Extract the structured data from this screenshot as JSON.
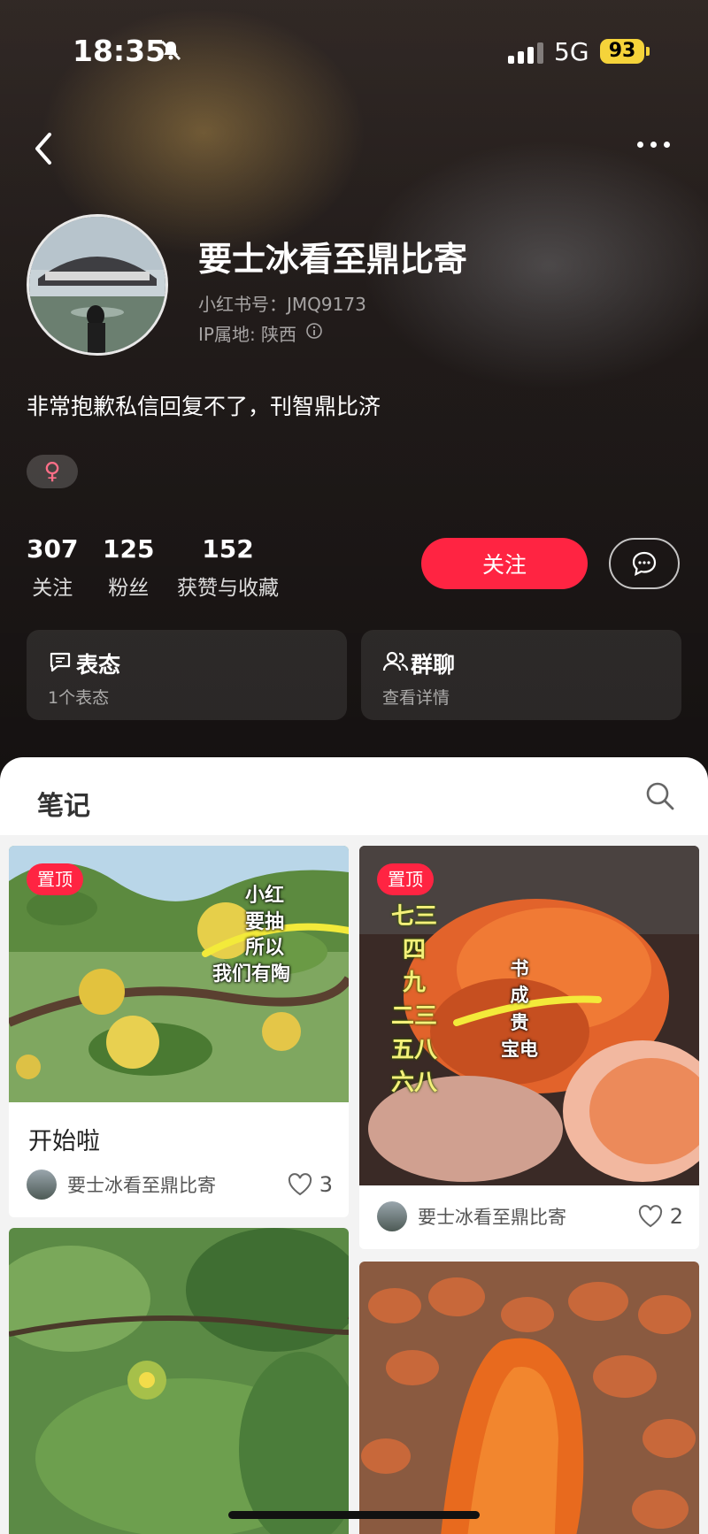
{
  "status": {
    "time": "18:35",
    "network": "5G",
    "battery": "93"
  },
  "profile": {
    "name": "要士冰看至鼎比寄",
    "id_line": "小红书号：JMQ9173",
    "ip_line": "IP属地: 陕西",
    "bio": "非常抱歉私信回复不了，刊智鼎比济",
    "gender_symbol": "♀"
  },
  "stats": [
    {
      "num": "307",
      "label": "关注"
    },
    {
      "num": "125",
      "label": "粉丝"
    },
    {
      "num": "152",
      "label": "获赞与收藏"
    }
  ],
  "actions": {
    "follow": "关注"
  },
  "cards": [
    {
      "title": "表态",
      "sub": "1个表态"
    },
    {
      "title": "群聊",
      "sub": "查看详情"
    }
  ],
  "sheet": {
    "tab": "笔记"
  },
  "notes": [
    {
      "pin": "置顶",
      "title": "开始啦",
      "author": "要士冰看至鼎比寄",
      "likes": "3",
      "overlay": [
        "小红",
        "要抽",
        "所以",
        "我们有陶"
      ]
    },
    {
      "pin": "置顶",
      "author": "要士冰看至鼎比寄",
      "likes": "2",
      "overlay_left": [
        "七三",
        "四",
        "九",
        "二三",
        "五八",
        "六八"
      ],
      "overlay_right": [
        "书",
        "成",
        "贵",
        "宝电"
      ]
    }
  ]
}
